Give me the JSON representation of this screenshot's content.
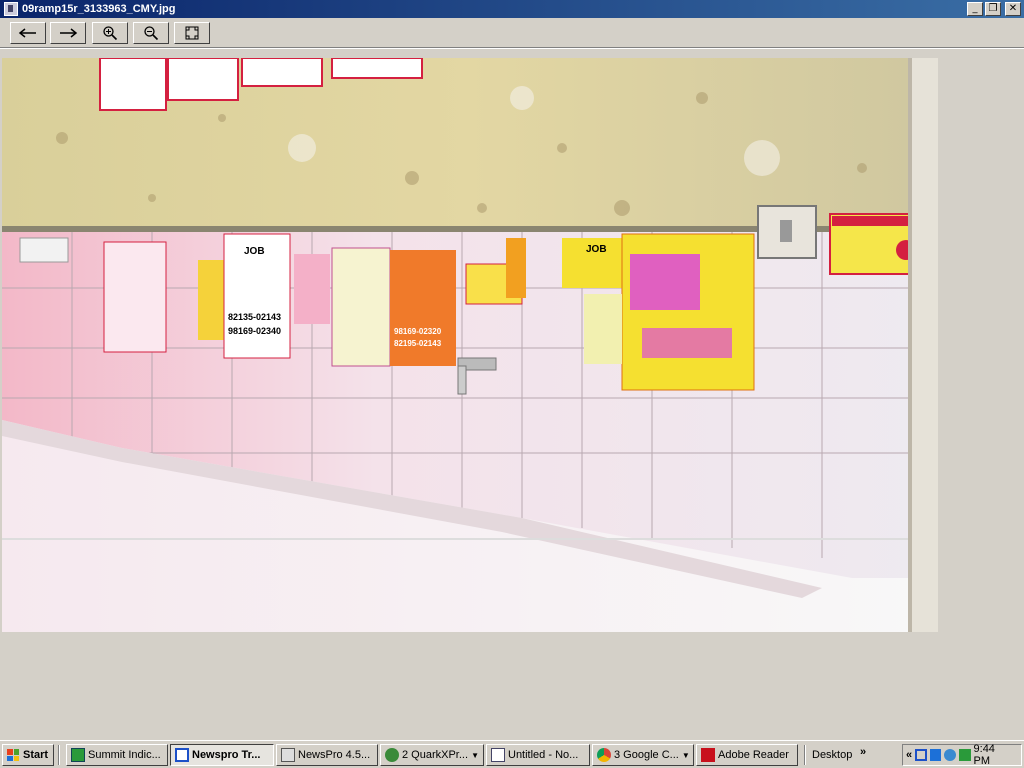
{
  "window": {
    "title": "09ramp15r_3133963_CMY.jpg",
    "minimize": "_",
    "restore": "❐",
    "close": "✕"
  },
  "toolbar": {
    "back": "←",
    "forward": "→",
    "zoom_in": "⊕",
    "zoom_out": "⊖",
    "fit": "⌖"
  },
  "photo_text": {
    "poster_job_1": "JOB",
    "poster_job_2": "JOB",
    "poster_phone_1": "82135-02143",
    "poster_phone_2": "98169-02340",
    "poster_phone_3": "98169-02320",
    "poster_phone_4": "82195-02143"
  },
  "taskbar": {
    "start": "Start",
    "items": [
      {
        "label": "Summit Indic..."
      },
      {
        "label": "Newspro Tr..."
      },
      {
        "label": "NewsPro 4.5..."
      },
      {
        "label": "2 QuarkXPr..."
      },
      {
        "label": "Untitled - No..."
      },
      {
        "label": "3 Google C..."
      },
      {
        "label": "Adobe Reader"
      }
    ],
    "desktop": "Desktop",
    "chevron": "»",
    "tray_chevron": "«",
    "clock": "9:44 PM"
  },
  "colors": {
    "titlebar_start": "#0a246a",
    "titlebar_end": "#3a6ea5",
    "chrome": "#d4d0c8"
  }
}
